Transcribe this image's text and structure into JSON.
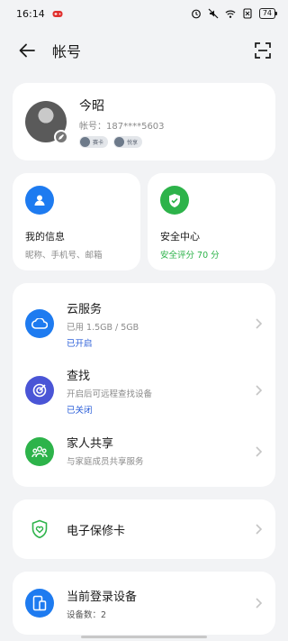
{
  "status_bar": {
    "time": "16:14",
    "battery": "74"
  },
  "header": {
    "title": "帐号"
  },
  "profile": {
    "name": "今昭",
    "account_label": "帐号：",
    "account_value": "187****5603",
    "badges": [
      "赛卡",
      "悦享"
    ]
  },
  "tiles": [
    {
      "title": "我的信息",
      "subtitle": "昵称、手机号、邮箱",
      "icon": "person-icon",
      "color": "#1e7bf0"
    },
    {
      "title": "安全中心",
      "subtitle": "安全评分 70 分",
      "icon": "shield-check-icon",
      "color": "#2db34a"
    }
  ],
  "services": [
    {
      "title": "云服务",
      "subtitle": "已用 1.5GB / 5GB",
      "status": "已开启",
      "icon": "cloud-icon",
      "color": "#1e7bf0"
    },
    {
      "title": "查找",
      "subtitle": "开启后可远程查找设备",
      "status": "已关闭",
      "icon": "find-icon",
      "color": "#4a55d6"
    },
    {
      "title": "家人共享",
      "subtitle": "与家庭成员共享服务",
      "status": "",
      "icon": "family-icon",
      "color": "#2db34a"
    }
  ],
  "warranty": {
    "title": "电子保修卡",
    "icon": "heart-shield-icon",
    "color": "#2db34a"
  },
  "devices": {
    "title": "当前登录设备",
    "subtitle": "设备数：2",
    "icon": "devices-icon",
    "color": "#1e7bf0"
  }
}
